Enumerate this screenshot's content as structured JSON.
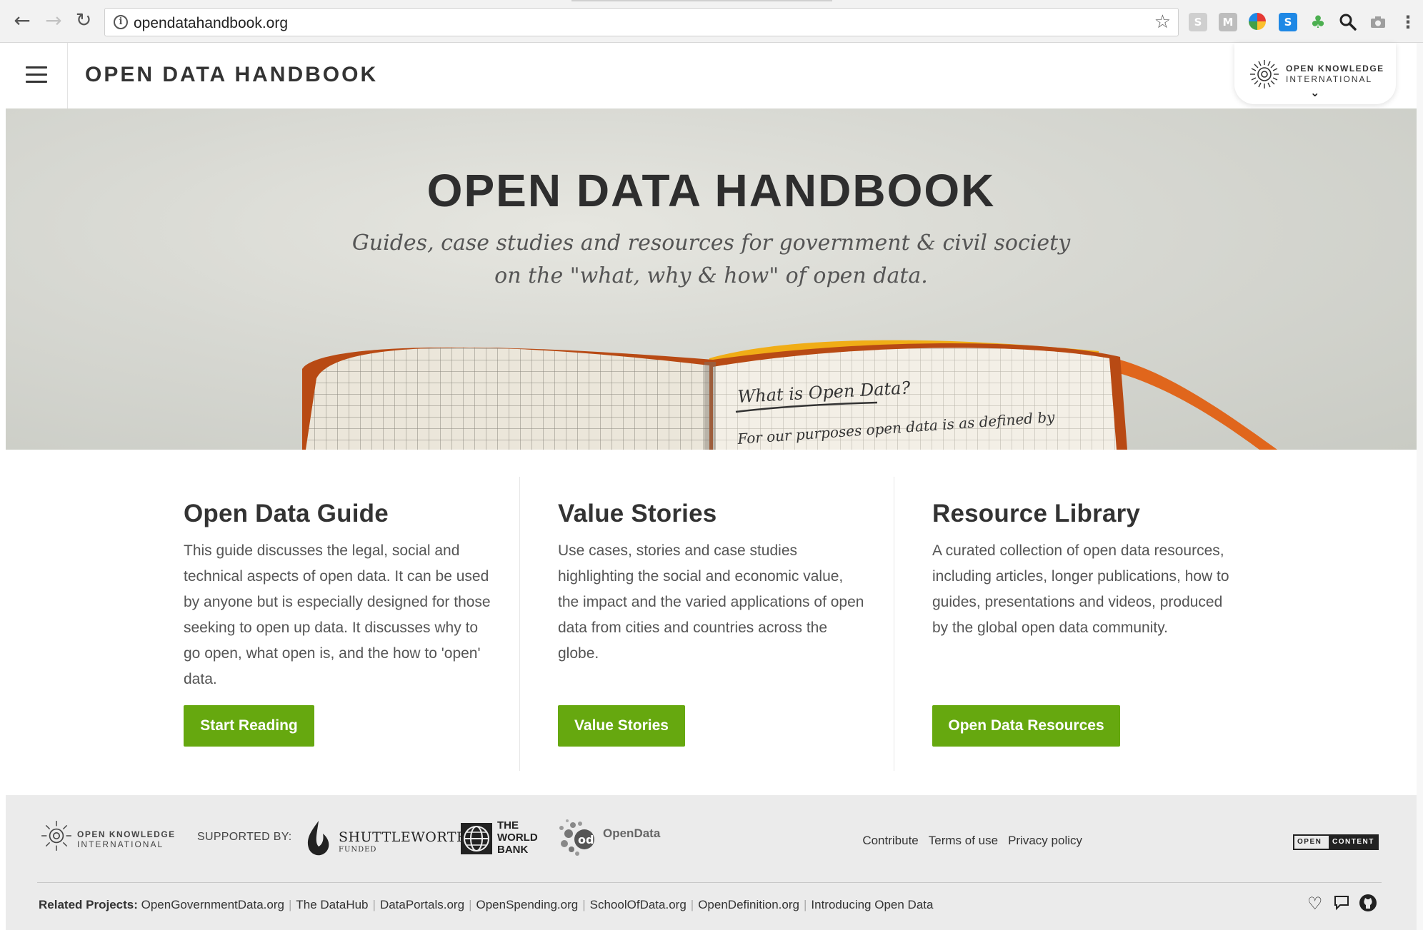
{
  "browser": {
    "url": "opendatahandbook.org",
    "icons": {
      "back": "back-arrow-icon",
      "forward": "forward-arrow-icon",
      "reload": "reload-icon",
      "site_info": "info-icon",
      "bookmark": "star-icon",
      "menu": "kebab-menu-icon"
    },
    "extensions": [
      "extension-gray-icon",
      "extension-m-icon",
      "extension-pinwheel-icon",
      "extension-s-icon",
      "extension-leaf-icon",
      "search-icon",
      "camera-icon"
    ]
  },
  "header": {
    "title": "OPEN DATA HANDBOOK",
    "org_badge": {
      "line1": "OPEN KNOWLEDGE",
      "line2": "INTERNATIONAL"
    }
  },
  "hero": {
    "title": "OPEN DATA HANDBOOK",
    "subtitle_line1": "Guides, case studies and resources for government & civil society",
    "subtitle_line2": "on the \"what, why & how\" of open data.",
    "notebook_line1": "What is Open Data?",
    "notebook_line2": "For our purposes open data is as defined by"
  },
  "columns": [
    {
      "heading": "Open Data Guide",
      "body": "This guide discusses the legal, social and technical aspects of open data. It can be used by anyone but is especially designed for those seeking to open up data. It discusses why to go open, what open is, and the how to 'open' data.",
      "button": "Start Reading"
    },
    {
      "heading": "Value Stories",
      "body": "Use cases, stories and case studies highlighting the social and economic value, the impact and the varied applications of open data from cities and countries across the globe.",
      "button": "Value Stories"
    },
    {
      "heading": "Resource Library",
      "body": "A curated collection of open data resources, including articles, longer publications, how to guides, presentations and videos, produced by the global open data community.",
      "button": "Open Data Resources"
    }
  ],
  "footer": {
    "oki_line1": "OPEN KNOWLEDGE",
    "oki_line2": "INTERNATIONAL",
    "supported_by": "SUPPORTED BY:",
    "shuttleworth": "SHUTTLEWORTH",
    "shuttleworth_sub": "FUNDED",
    "world_bank": [
      "THE",
      "WORLD",
      "BANK"
    ],
    "opendata": "OpenData",
    "links": [
      "Contribute",
      "Terms of use",
      "Privacy policy"
    ],
    "open_content": {
      "a": "OPEN",
      "b": "CONTENT"
    },
    "related_label": "Related Projects:",
    "related": [
      "OpenGovernmentData.org",
      "The DataHub",
      "DataPortals.org",
      "OpenSpending.org",
      "SchoolOfData.org",
      "OpenDefinition.org",
      "Introducing Open Data"
    ],
    "social_icons": [
      "heart-icon",
      "chat-icon",
      "github-icon"
    ]
  },
  "colors": {
    "accent_green": "#66a80f",
    "text_dark": "#333333",
    "footer_bg": "#ebebeb"
  }
}
